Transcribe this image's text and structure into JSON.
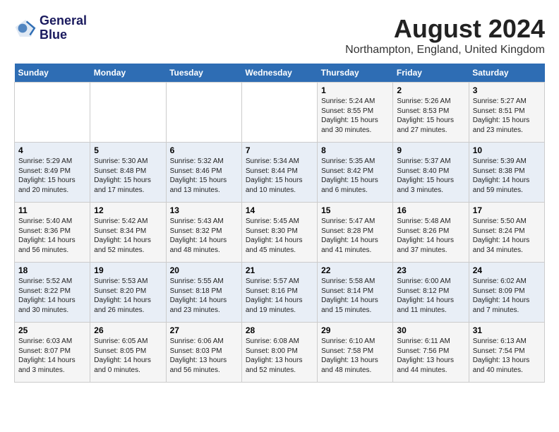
{
  "header": {
    "logo_line1": "General",
    "logo_line2": "Blue",
    "month_year": "August 2024",
    "location": "Northampton, England, United Kingdom"
  },
  "days_of_week": [
    "Sunday",
    "Monday",
    "Tuesday",
    "Wednesday",
    "Thursday",
    "Friday",
    "Saturday"
  ],
  "weeks": [
    [
      {
        "day": "",
        "content": ""
      },
      {
        "day": "",
        "content": ""
      },
      {
        "day": "",
        "content": ""
      },
      {
        "day": "",
        "content": ""
      },
      {
        "day": "1",
        "content": "Sunrise: 5:24 AM\nSunset: 8:55 PM\nDaylight: 15 hours\nand 30 minutes."
      },
      {
        "day": "2",
        "content": "Sunrise: 5:26 AM\nSunset: 8:53 PM\nDaylight: 15 hours\nand 27 minutes."
      },
      {
        "day": "3",
        "content": "Sunrise: 5:27 AM\nSunset: 8:51 PM\nDaylight: 15 hours\nand 23 minutes."
      }
    ],
    [
      {
        "day": "4",
        "content": "Sunrise: 5:29 AM\nSunset: 8:49 PM\nDaylight: 15 hours\nand 20 minutes."
      },
      {
        "day": "5",
        "content": "Sunrise: 5:30 AM\nSunset: 8:48 PM\nDaylight: 15 hours\nand 17 minutes."
      },
      {
        "day": "6",
        "content": "Sunrise: 5:32 AM\nSunset: 8:46 PM\nDaylight: 15 hours\nand 13 minutes."
      },
      {
        "day": "7",
        "content": "Sunrise: 5:34 AM\nSunset: 8:44 PM\nDaylight: 15 hours\nand 10 minutes."
      },
      {
        "day": "8",
        "content": "Sunrise: 5:35 AM\nSunset: 8:42 PM\nDaylight: 15 hours\nand 6 minutes."
      },
      {
        "day": "9",
        "content": "Sunrise: 5:37 AM\nSunset: 8:40 PM\nDaylight: 15 hours\nand 3 minutes."
      },
      {
        "day": "10",
        "content": "Sunrise: 5:39 AM\nSunset: 8:38 PM\nDaylight: 14 hours\nand 59 minutes."
      }
    ],
    [
      {
        "day": "11",
        "content": "Sunrise: 5:40 AM\nSunset: 8:36 PM\nDaylight: 14 hours\nand 56 minutes."
      },
      {
        "day": "12",
        "content": "Sunrise: 5:42 AM\nSunset: 8:34 PM\nDaylight: 14 hours\nand 52 minutes."
      },
      {
        "day": "13",
        "content": "Sunrise: 5:43 AM\nSunset: 8:32 PM\nDaylight: 14 hours\nand 48 minutes."
      },
      {
        "day": "14",
        "content": "Sunrise: 5:45 AM\nSunset: 8:30 PM\nDaylight: 14 hours\nand 45 minutes."
      },
      {
        "day": "15",
        "content": "Sunrise: 5:47 AM\nSunset: 8:28 PM\nDaylight: 14 hours\nand 41 minutes."
      },
      {
        "day": "16",
        "content": "Sunrise: 5:48 AM\nSunset: 8:26 PM\nDaylight: 14 hours\nand 37 minutes."
      },
      {
        "day": "17",
        "content": "Sunrise: 5:50 AM\nSunset: 8:24 PM\nDaylight: 14 hours\nand 34 minutes."
      }
    ],
    [
      {
        "day": "18",
        "content": "Sunrise: 5:52 AM\nSunset: 8:22 PM\nDaylight: 14 hours\nand 30 minutes."
      },
      {
        "day": "19",
        "content": "Sunrise: 5:53 AM\nSunset: 8:20 PM\nDaylight: 14 hours\nand 26 minutes."
      },
      {
        "day": "20",
        "content": "Sunrise: 5:55 AM\nSunset: 8:18 PM\nDaylight: 14 hours\nand 23 minutes."
      },
      {
        "day": "21",
        "content": "Sunrise: 5:57 AM\nSunset: 8:16 PM\nDaylight: 14 hours\nand 19 minutes."
      },
      {
        "day": "22",
        "content": "Sunrise: 5:58 AM\nSunset: 8:14 PM\nDaylight: 14 hours\nand 15 minutes."
      },
      {
        "day": "23",
        "content": "Sunrise: 6:00 AM\nSunset: 8:12 PM\nDaylight: 14 hours\nand 11 minutes."
      },
      {
        "day": "24",
        "content": "Sunrise: 6:02 AM\nSunset: 8:09 PM\nDaylight: 14 hours\nand 7 minutes."
      }
    ],
    [
      {
        "day": "25",
        "content": "Sunrise: 6:03 AM\nSunset: 8:07 PM\nDaylight: 14 hours\nand 3 minutes."
      },
      {
        "day": "26",
        "content": "Sunrise: 6:05 AM\nSunset: 8:05 PM\nDaylight: 14 hours\nand 0 minutes."
      },
      {
        "day": "27",
        "content": "Sunrise: 6:06 AM\nSunset: 8:03 PM\nDaylight: 13 hours\nand 56 minutes."
      },
      {
        "day": "28",
        "content": "Sunrise: 6:08 AM\nSunset: 8:00 PM\nDaylight: 13 hours\nand 52 minutes."
      },
      {
        "day": "29",
        "content": "Sunrise: 6:10 AM\nSunset: 7:58 PM\nDaylight: 13 hours\nand 48 minutes."
      },
      {
        "day": "30",
        "content": "Sunrise: 6:11 AM\nSunset: 7:56 PM\nDaylight: 13 hours\nand 44 minutes."
      },
      {
        "day": "31",
        "content": "Sunrise: 6:13 AM\nSunset: 7:54 PM\nDaylight: 13 hours\nand 40 minutes."
      }
    ]
  ]
}
